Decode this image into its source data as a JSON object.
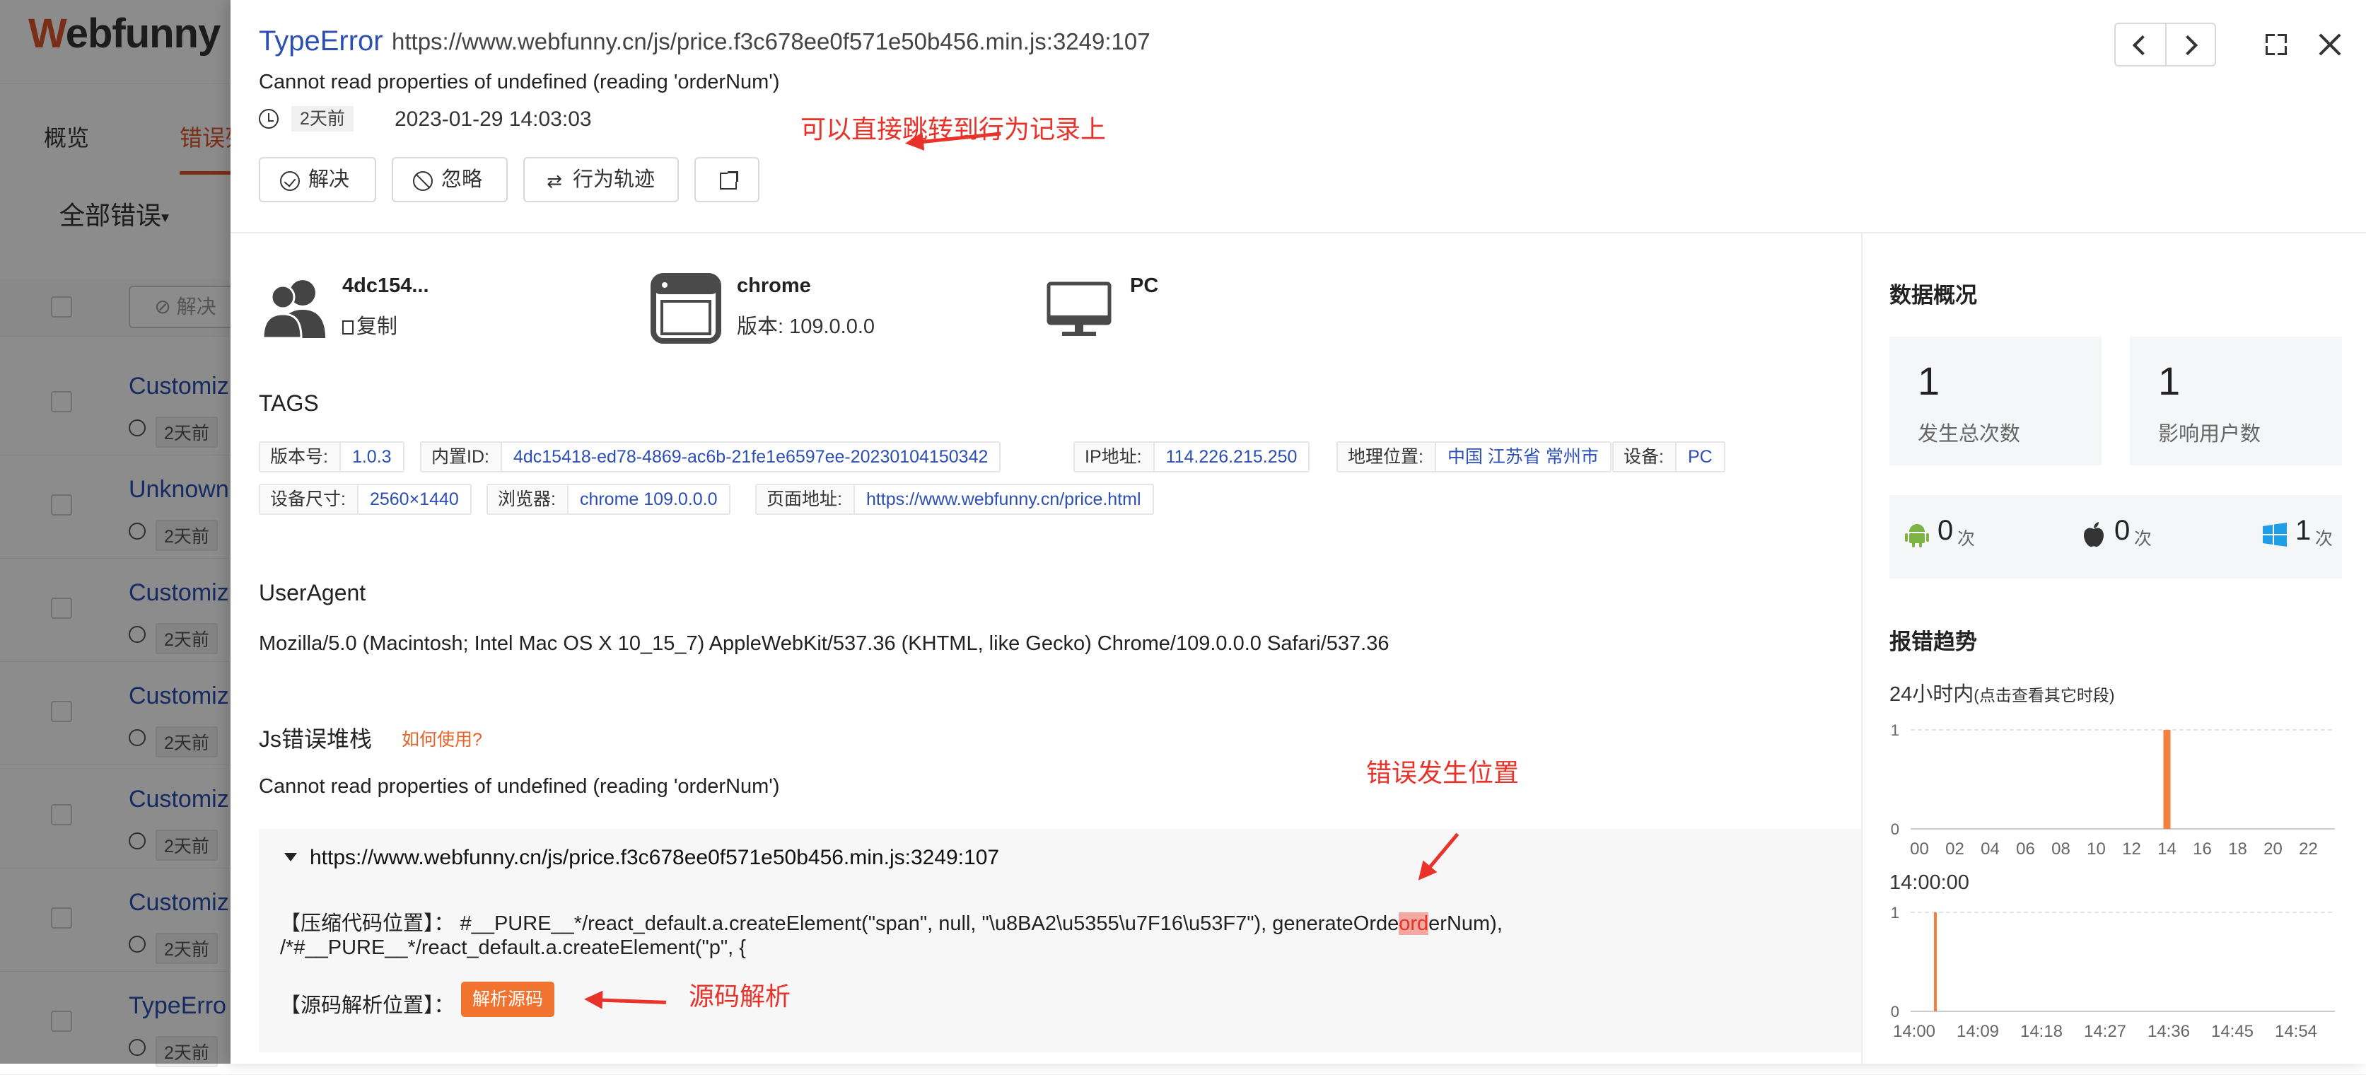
{
  "background": {
    "logo": {
      "w": "W",
      "rest": "ebfunny"
    },
    "tabs": [
      "概览",
      "错误列"
    ],
    "filter_label": "全部错误",
    "resolve_button": "解决",
    "rows": [
      {
        "title": "Customiz",
        "ago": "2天前"
      },
      {
        "title": "Unknown",
        "ago": "2天前"
      },
      {
        "title": "Customiz",
        "ago": "2天前"
      },
      {
        "title": "Customiz",
        "ago": "2天前"
      },
      {
        "title": "Customiz",
        "ago": "2天前"
      },
      {
        "title": "Customiz",
        "ago": "2天前"
      },
      {
        "title": "TypeErro",
        "ago": "2天前"
      }
    ]
  },
  "error": {
    "type": "TypeError",
    "url": "https://www.webfunny.cn/js/price.f3c678ee0f571e50b456.min.js:3249:107",
    "message": "Cannot read properties of undefined (reading 'orderNum')",
    "ago": "2天前",
    "time": "2023-01-29 14:03:03"
  },
  "actions": {
    "resolve": "解决",
    "ignore": "忽略",
    "trace": "行为轨迹",
    "swap_glyph": "⇄"
  },
  "annotations": {
    "jump_to_trace": "可以直接跳转到行为记录上",
    "error_location": "错误发生位置",
    "source_parse": "源码解析"
  },
  "info": {
    "user_id": "4dc154...",
    "copy": "复制",
    "browser": "chrome",
    "browser_version": "版本: 109.0.0.0",
    "device": "PC"
  },
  "tags_title": "TAGS",
  "tags": [
    [
      {
        "k": "版本号:",
        "v": "1.0.3"
      },
      {
        "k": "内置ID:",
        "v": "4dc15418-ed78-4869-ac6b-21fe1e6597ee-20230104150342"
      },
      {
        "k": "IP地址:",
        "v": "114.226.215.250"
      },
      {
        "k": "地理位置:",
        "v": "中国 江苏省 常州市"
      },
      {
        "k": "设备:",
        "v": "PC"
      }
    ],
    [
      {
        "k": "设备尺寸:",
        "v": "2560×1440"
      },
      {
        "k": "浏览器:",
        "v": "chrome 109.0.0.0"
      },
      {
        "k": "页面地址:",
        "v": "https://www.webfunny.cn/price.html"
      }
    ]
  ],
  "useragent": {
    "title": "UserAgent",
    "text": "Mozilla/5.0 (Macintosh; Intel Mac OS X 10_15_7) AppleWebKit/537.36 (KHTML, like Gecko) Chrome/109.0.0.0 Safari/537.36"
  },
  "stack": {
    "title": "Js错误堆栈",
    "howto": "如何使用?",
    "message": "Cannot read properties of undefined (reading 'orderNum')",
    "file": "https://www.webfunny.cn/js/price.f3c678ee0f571e50b456.min.js:3249:107",
    "compressed_label": "【压缩代码位置】：",
    "compressed_before": "#__PURE__*/react_default.a.createElement(\"span\", null, \"\\u8BA2\\u5355\\u7F16\\u53F7\"), generateOrde",
    "compressed_highlight": "ord",
    "compressed_after": "erNum),",
    "compressed_line2": "/*#__PURE__*/react_default.a.createElement(\"p\", {",
    "source_label": "【源码解析位置】：",
    "parse_button": "解析源码"
  },
  "overview": {
    "title": "数据概况",
    "total_count": "1",
    "total_label": "发生总次数",
    "users_count": "1",
    "users_label": "影响用户数",
    "platforms": [
      {
        "name": "android",
        "count": "0",
        "unit": "次"
      },
      {
        "name": "apple",
        "count": "0",
        "unit": "次"
      },
      {
        "name": "windows",
        "count": "1",
        "unit": "次"
      }
    ]
  },
  "trend": {
    "title": "报错趋势",
    "range_label": "24小时内",
    "range_hint": "(点击查看其它时段)",
    "detail_time": "14:00:00"
  },
  "colors": {
    "accent": "#e8632a",
    "link": "#2b4fb5",
    "bar": "#f0813f",
    "annotation": "#e8322a"
  },
  "chart_data": [
    {
      "type": "bar",
      "categories": [
        "00",
        "01",
        "02",
        "03",
        "04",
        "05",
        "06",
        "07",
        "08",
        "09",
        "10",
        "11",
        "12",
        "13",
        "14",
        "15",
        "16",
        "17",
        "18",
        "19",
        "20",
        "21",
        "22",
        "23"
      ],
      "tick_labels": [
        "00",
        "02",
        "04",
        "06",
        "08",
        "10",
        "12",
        "14",
        "16",
        "18",
        "20",
        "22"
      ],
      "values": [
        0,
        0,
        0,
        0,
        0,
        0,
        0,
        0,
        0,
        0,
        0,
        0,
        0,
        0,
        1,
        0,
        0,
        0,
        0,
        0,
        0,
        0,
        0,
        0
      ],
      "ylim": [
        0,
        1
      ],
      "y_ticks": [
        "0",
        "1"
      ]
    },
    {
      "type": "bar",
      "categories": [
        "14:00",
        "14:01",
        "14:02",
        "14:03",
        "14:04",
        "14:05",
        "14:06",
        "14:07",
        "14:08",
        "14:09",
        "14:10",
        "14:11",
        "14:12",
        "14:13",
        "14:14",
        "14:15",
        "14:16",
        "14:17",
        "14:18",
        "14:19",
        "14:20",
        "14:21",
        "14:22",
        "14:23",
        "14:24",
        "14:25",
        "14:26",
        "14:27",
        "14:28",
        "14:29",
        "14:30",
        "14:31",
        "14:32",
        "14:33",
        "14:34",
        "14:35",
        "14:36",
        "14:37",
        "14:38",
        "14:39",
        "14:40",
        "14:41",
        "14:42",
        "14:43",
        "14:44",
        "14:45",
        "14:46",
        "14:47",
        "14:48",
        "14:49",
        "14:50",
        "14:51",
        "14:52",
        "14:53",
        "14:54",
        "14:55",
        "14:56",
        "14:57",
        "14:58",
        "14:59"
      ],
      "tick_labels": [
        "14:00",
        "14:09",
        "14:18",
        "14:27",
        "14:36",
        "14:45",
        "14:54"
      ],
      "values": [
        0,
        0,
        0,
        1,
        0,
        0,
        0,
        0,
        0,
        0,
        0,
        0,
        0,
        0,
        0,
        0,
        0,
        0,
        0,
        0,
        0,
        0,
        0,
        0,
        0,
        0,
        0,
        0,
        0,
        0,
        0,
        0,
        0,
        0,
        0,
        0,
        0,
        0,
        0,
        0,
        0,
        0,
        0,
        0,
        0,
        0,
        0,
        0,
        0,
        0,
        0,
        0,
        0,
        0,
        0,
        0,
        0,
        0,
        0,
        0
      ],
      "ylim": [
        0,
        1
      ],
      "y_ticks": [
        "0",
        "1"
      ]
    }
  ]
}
